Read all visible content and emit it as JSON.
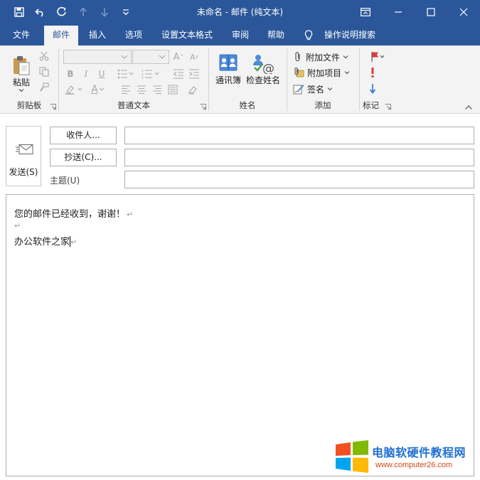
{
  "window": {
    "title": "未命名  -  邮件 (纯文本)"
  },
  "qat": {
    "icons": [
      "save-icon",
      "undo-icon",
      "redo-icon",
      "up-arrow-icon",
      "down-arrow-icon",
      "customize-icon"
    ]
  },
  "tabs": [
    {
      "label": "文件",
      "active": false
    },
    {
      "label": "邮件",
      "active": true
    },
    {
      "label": "插入",
      "active": false
    },
    {
      "label": "选项",
      "active": false
    },
    {
      "label": "设置文本格式",
      "active": false
    },
    {
      "label": "审阅",
      "active": false
    },
    {
      "label": "帮助",
      "active": false
    },
    {
      "label": "操作说明搜索",
      "active": false
    }
  ],
  "ribbon": {
    "clipboard": {
      "label": "剪贴板",
      "paste": "粘贴"
    },
    "basic_text": {
      "label": "普通文本"
    },
    "names": {
      "label": "姓名",
      "address_book": "通讯簿",
      "check_names": "检查姓名"
    },
    "include": {
      "label": "添加",
      "attach_file": "附加文件",
      "attach_item": "附加项目",
      "signature": "签名"
    },
    "tags": {
      "label": "标记"
    }
  },
  "compose": {
    "send": "发送(S)",
    "to": "收件人...",
    "cc": "抄送(C)...",
    "subject_label": "主题(U)",
    "to_value": "",
    "cc_value": "",
    "subject_value": "",
    "body_lines": [
      "您的邮件已经收到，谢谢！",
      "",
      "办公软件之家"
    ]
  },
  "watermark": {
    "title": "电脑软硬件教程网",
    "url": "www.computer26.com"
  },
  "colors": {
    "accent": "#2b579a",
    "ribbon_bg": "#f3f3f3",
    "flag_red": "#e03a3a",
    "arrow_blue": "#2b6fc7"
  }
}
